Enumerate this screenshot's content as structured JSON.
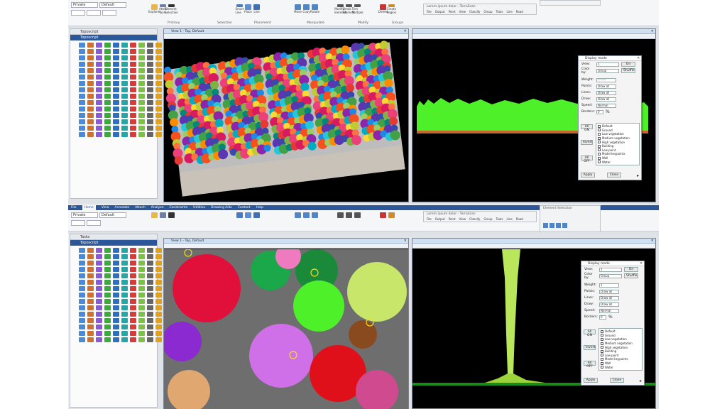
{
  "top": {
    "level_combo": "Private",
    "attr_combo": "Default",
    "tool_labels": [
      "Explorer",
      "Attrib Tools",
      "Element Selection",
      "Smart Line",
      "Place",
      "Line",
      "Move",
      "Copy",
      "Rotate",
      "Modify Element",
      "Break Element",
      "Trim Multiple",
      "Delete",
      "Create Region"
    ],
    "group_labels": [
      "Primary",
      "Selection",
      "Placement",
      "Manipulate",
      "Modify",
      "Groups"
    ],
    "panel_title": "Toposcript",
    "panel_sub": "Toposcript",
    "view1_title": "View 1 - Top, Default",
    "view2_title": "",
    "winbar_title": "Lorem ipsum dolor - TerraScan",
    "winbar_menu": [
      "File",
      "Output",
      "Point",
      "View",
      "Classify",
      "Group",
      "Tools",
      "Line",
      "Road"
    ],
    "dialog": {
      "title": "Display mode",
      "view_label": "View:",
      "view_value": "1",
      "view_btn": "On",
      "colorby_label": "Color by:",
      "colorby_value": "Group",
      "shuffle_btn": "Shuffle",
      "weight_label": "Weight:",
      "weight_value": "———",
      "points_label": "Points:",
      "points_value": "Draw all",
      "lines_label": "Lines:",
      "lines_value": "Draw all",
      "draw_label": "Draw:",
      "draw_value": "Draw all",
      "speed_label": "Speed:",
      "speed_value": "Normal",
      "borders_label": "Borders:",
      "borders_value": "0",
      "borders_unit": "%",
      "side_btns": [
        "All ON",
        "Invert",
        "All OFF"
      ],
      "classes": [
        "Default",
        "Ground",
        "Low vegetation",
        "Medium vegetation",
        "High vegetation",
        "Building",
        "Low point",
        "Model keypoints",
        "Wall",
        "Water"
      ],
      "apply_btn": "Apply",
      "close_btn": "Close"
    }
  },
  "bottom": {
    "menu_tabs": [
      "File",
      "Home",
      "View",
      "Annotate",
      "Attach",
      "Analyze",
      "Constraints",
      "Utilities",
      "Drawing Aids",
      "Content",
      "Help"
    ],
    "level_combo": "Private",
    "attr_combo": "Default",
    "panel_title": "Tasks",
    "panel_sub": "Toposcript",
    "view1_title": "View 1 - Top, Default",
    "winbar_title": "Lorem ipsum dolor - TerraScan",
    "winbar_menu": [
      "File",
      "Output",
      "Point",
      "View",
      "Classify",
      "Group",
      "Tools",
      "Line",
      "Road"
    ],
    "mini_title": "Element Selection",
    "dialog": {
      "title": "Display mode",
      "view_label": "View:",
      "view_value": "1",
      "view_btn": "On",
      "colorby_label": "Color by:",
      "colorby_value": "Group",
      "shuffle_btn": "Shuffle",
      "weight_label": "Weight:",
      "weight_value": "1",
      "points_label": "Points:",
      "points_value": "Draw all",
      "lines_label": "Lines:",
      "lines_value": "Draw all",
      "draw_label": "Draw:",
      "draw_value": "Draw all",
      "speed_label": "Speed:",
      "speed_value": "Normal",
      "borders_label": "Borders:",
      "borders_value": "0",
      "borders_unit": "%",
      "side_btns": [
        "All ON",
        "Invert",
        "All OFF"
      ],
      "classes": [
        "Default",
        "Ground",
        "Low vegetation",
        "Medium vegetation",
        "High vegetation",
        "Building",
        "Low point",
        "Model keypoints",
        "Wall",
        "Water"
      ],
      "apply_btn": "Apply",
      "close_btn": "Close"
    }
  },
  "colors": {
    "accent": "#2b579a",
    "canopy": "#4ef02a",
    "trunk": "#b9e65a",
    "tree_red": "#e0103a",
    "tree_pink": "#d070e8"
  }
}
